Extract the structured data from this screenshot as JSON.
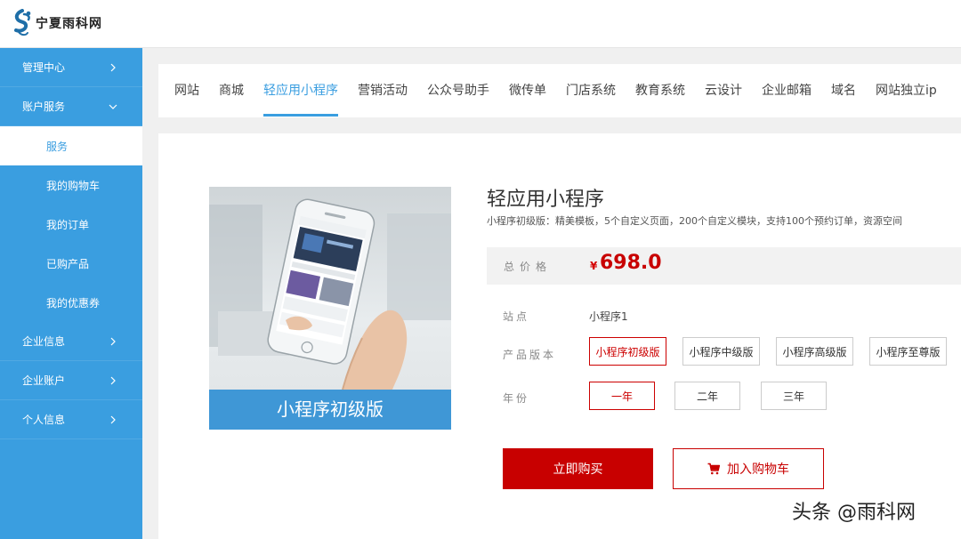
{
  "brand": {
    "name": "宁夏雨科网"
  },
  "sidebar": {
    "items": [
      {
        "label": "管理中心",
        "type": "top",
        "chevron": "right"
      },
      {
        "label": "账户服务",
        "type": "top",
        "chevron": "down"
      },
      {
        "label": "服务",
        "type": "sub",
        "active": true
      },
      {
        "label": "我的购物车",
        "type": "sub"
      },
      {
        "label": "我的订单",
        "type": "sub"
      },
      {
        "label": "已购产品",
        "type": "sub"
      },
      {
        "label": "我的优惠券",
        "type": "sub"
      },
      {
        "label": "企业信息",
        "type": "top",
        "chevron": "right"
      },
      {
        "label": "企业账户",
        "type": "top",
        "chevron": "right"
      },
      {
        "label": "个人信息",
        "type": "top",
        "chevron": "right"
      }
    ]
  },
  "tabs": [
    {
      "label": "网站"
    },
    {
      "label": "商城"
    },
    {
      "label": "轻应用小程序",
      "active": true
    },
    {
      "label": "营销活动"
    },
    {
      "label": "公众号助手"
    },
    {
      "label": "微传单"
    },
    {
      "label": "门店系统"
    },
    {
      "label": "教育系统"
    },
    {
      "label": "云设计"
    },
    {
      "label": "企业邮箱"
    },
    {
      "label": "域名"
    },
    {
      "label": "网站独立ip"
    }
  ],
  "product": {
    "image_caption": "小程序初级版",
    "title": "轻应用小程序",
    "description": "小程序初级版：精美模板，5个自定义页面，200个自定义模块，支持100个预约订单，资源空间",
    "price_label": "总价格",
    "currency": "¥",
    "price": "698.0",
    "site_label": "站点",
    "site_value": "小程序1",
    "version_label": "产品版本",
    "versions": [
      "小程序初级版",
      "小程序中级版",
      "小程序高级版",
      "小程序至尊版"
    ],
    "selected_version": 0,
    "year_label": "年份",
    "years": [
      "一年",
      "二年",
      "三年"
    ],
    "selected_year": 0,
    "buy_label": "立即购买",
    "cart_label": "加入购物车"
  },
  "watermark": "头条 @雨科网",
  "colors": {
    "sidebar": "#3a9ee0",
    "accent": "#3a9ee0",
    "price": "#c80000",
    "selected_border": "#cc0000"
  }
}
